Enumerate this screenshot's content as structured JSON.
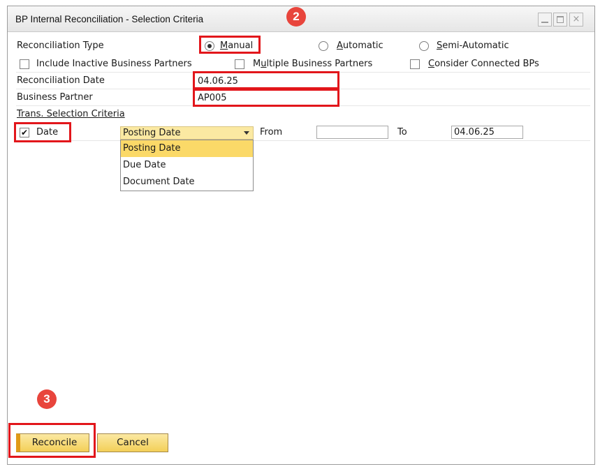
{
  "window": {
    "title": "BP Internal Reconciliation - Selection Criteria",
    "minimize_icon": "minimize-icon",
    "maximize_icon": "maximize-icon",
    "close_icon": "close-icon",
    "close_glyph": "×"
  },
  "form": {
    "reconciliation_type_label": "Reconciliation Type",
    "radio_options": [
      {
        "hotkey": "M",
        "rest": "anual",
        "selected": true
      },
      {
        "hotkey": "A",
        "rest": "utomatic",
        "selected": false
      },
      {
        "hotkey": "S",
        "rest": "emi-Automatic",
        "selected": false
      }
    ],
    "checkboxes": {
      "include_inactive": {
        "label": "Include Inactive Business Partners",
        "checked": false
      },
      "multiple_bps": {
        "pre": "M",
        "hotkey": "u",
        "rest": "ltiple Business Partners",
        "checked": false
      },
      "connected_bps": {
        "hotkey": "C",
        "rest": "onsider Connected BPs",
        "checked": false
      }
    },
    "reconciliation_date_label": "Reconciliation Date",
    "reconciliation_date_value": "04.06.25",
    "business_partner_label": "Business Partner",
    "business_partner_value": "AP005",
    "trans_criteria_label": "Trans. Selection Criteria",
    "date_checkbox_label": "Date",
    "date_checkbox_checked": true,
    "check_glyph": "✔",
    "date_type_selected": "Posting Date",
    "date_type_options": [
      "Posting Date",
      "Due Date",
      "Document Date"
    ],
    "from_label": "From",
    "from_value": "",
    "to_label": "To",
    "to_value": "04.06.25"
  },
  "buttons": {
    "reconcile": "Reconcile",
    "cancel": "Cancel"
  },
  "annotations": {
    "badge_2": "2",
    "badge_3": "3",
    "highlight_color": "#e2161b",
    "badge_color": "#e8453c"
  },
  "colors": {
    "button_fill": "#f3cf57",
    "dropdown_selected": "#fbd968",
    "select_fill": "#fbe9a2"
  }
}
